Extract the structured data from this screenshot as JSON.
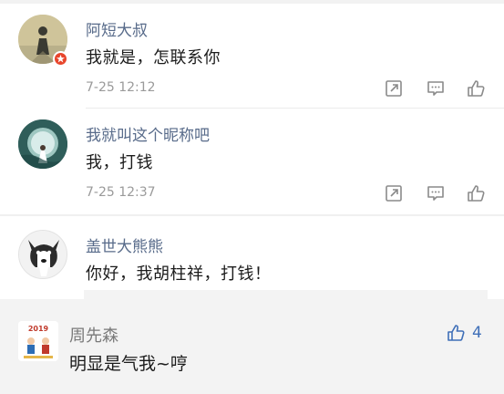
{
  "comments": [
    {
      "user": "阿短大叔",
      "text": "我就是，怎联系你",
      "time": "7-25 12:12",
      "avatar_icon": "person-silhouette-avatar",
      "badge_icon": "star-badge-icon"
    },
    {
      "user": "我就叫这个昵称吧",
      "text": "我，打钱",
      "time": "7-25 12:37",
      "avatar_icon": "wedding-photo-avatar"
    },
    {
      "user": "盖世大熊熊",
      "text": "你好，我胡柱祥，打钱！",
      "avatar_icon": "husky-dog-avatar"
    }
  ],
  "reply": {
    "user": "周先森",
    "text": "明显是气我~哼",
    "likes": "4",
    "avatar_icon": "2019-cartoon-avatar",
    "avatar_label": "2019"
  },
  "icons": {
    "share": "share-icon",
    "comment": "comment-icon",
    "like": "thumbs-up-icon"
  },
  "colors": {
    "username": "#586b8a",
    "time": "#9a9a9a",
    "like_accent": "#3f6fb8",
    "reply_bg": "#f3f3f3",
    "badge": "#e8452c"
  }
}
